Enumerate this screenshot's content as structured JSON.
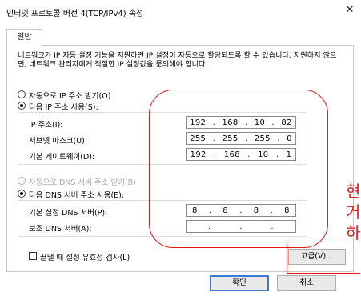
{
  "window": {
    "title": "인터넷 프로토콜 버전 4(TCP/IPv4) 속성",
    "close_glyph": "✕"
  },
  "tabs": [
    {
      "label": "일반"
    }
  ],
  "description": "네트워크가 IP 자동 설정 기능을 지원하면 IP 설정이 자동으로 할당되도록 할 수 있습니다. 지원하지 않으면, 네트워크 관리자에게 적절한 IP 설정값을 문의해야 합니다.",
  "ip_section": {
    "auto_label": "자동으로 IP 주소 받기(O)",
    "manual_label": "다음 IP 주소 사용(S):",
    "selected": "manual",
    "fields": [
      {
        "label": "IP 주소(I):",
        "octets": [
          "192",
          "168",
          "10",
          "82"
        ]
      },
      {
        "label": "서브넷 마스크(U):",
        "octets": [
          "255",
          "255",
          "255",
          "0"
        ]
      },
      {
        "label": "기본 게이트웨이(D):",
        "octets": [
          "192",
          "168",
          "10",
          "1"
        ]
      }
    ]
  },
  "dns_section": {
    "auto_label": "자동으로 DNS 서버 주소 받기(B)",
    "auto_enabled": false,
    "manual_label": "다음 DNS 서버 주소 사용(E):",
    "selected": "manual",
    "fields": [
      {
        "label": "기본 설정 DNS 서버(P):",
        "octets": [
          "8",
          "8",
          "8",
          "8"
        ]
      },
      {
        "label": "보조 DNS 서버(A):",
        "octets": [
          "",
          "",
          "",
          ""
        ]
      }
    ]
  },
  "validate_checkbox": {
    "label": "끝낼 때 설정 유효성 검사(L)",
    "checked": false
  },
  "buttons": {
    "advanced": "고급(V)...",
    "ok": "확인",
    "cancel": "취소"
  },
  "annotation": {
    "lines": [
      "현",
      "거",
      "하"
    ],
    "color": "#e11a1a"
  }
}
